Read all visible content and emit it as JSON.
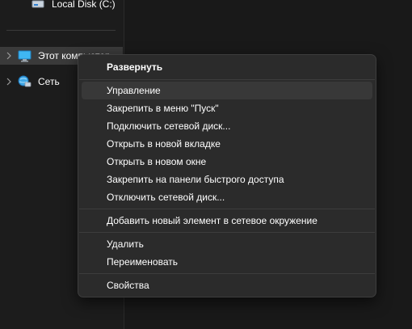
{
  "nav": {
    "items": [
      {
        "label": "Local Disk (C:)",
        "icon": "drive-icon"
      },
      {
        "label": "Этот компьютер",
        "icon": "computer-icon"
      },
      {
        "label": "Сеть",
        "icon": "network-icon"
      }
    ]
  },
  "context_menu": {
    "items": [
      {
        "label": "Развернуть"
      },
      {
        "label": "Управление"
      },
      {
        "label": "Закрепить в меню \"Пуск\""
      },
      {
        "label": "Подключить сетевой диск..."
      },
      {
        "label": "Открыть в новой вкладке"
      },
      {
        "label": "Открыть в новом окне"
      },
      {
        "label": "Закрепить на панели быстрого доступа"
      },
      {
        "label": "Отключить сетевой диск..."
      },
      {
        "label": "Добавить новый элемент в сетевое окружение"
      },
      {
        "label": "Удалить"
      },
      {
        "label": "Переименовать"
      },
      {
        "label": "Свойства"
      }
    ]
  },
  "colors": {
    "background": "#1c1c1c",
    "menu_background": "#2b2b2b",
    "hover": "#383838",
    "selected": "#3a3a3a",
    "text": "#ffffff"
  }
}
